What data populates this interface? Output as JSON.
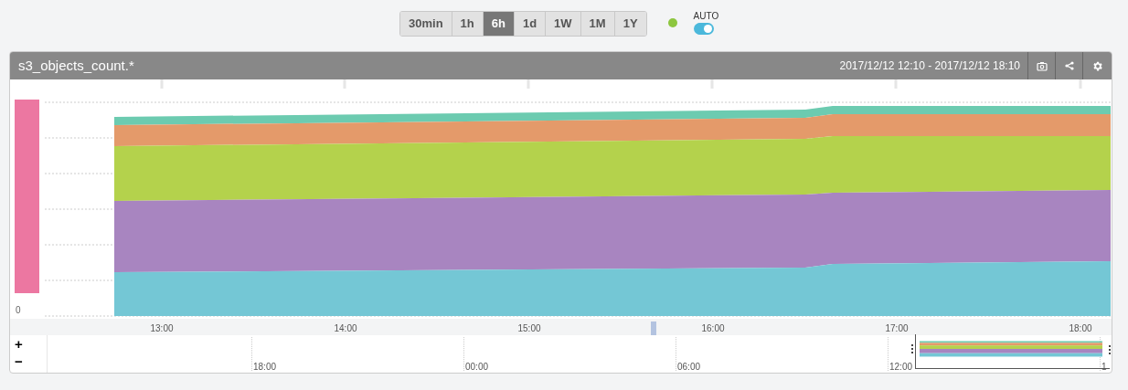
{
  "range_buttons": [
    {
      "label": "30min",
      "selected": false
    },
    {
      "label": "1h",
      "selected": false
    },
    {
      "label": "6h",
      "selected": true
    },
    {
      "label": "1d",
      "selected": false
    },
    {
      "label": "1W",
      "selected": false
    },
    {
      "label": "1M",
      "selected": false
    },
    {
      "label": "1Y",
      "selected": false
    }
  ],
  "auto_refresh": {
    "label": "AUTO",
    "on": true
  },
  "panel": {
    "title": "s3_objects_count.*",
    "time_range": "2017/12/12 12:10 - 2017/12/12 18:10",
    "y_axis_labels": [
      "0"
    ],
    "x_axis_labels": [
      "13:00",
      "14:00",
      "15:00",
      "16:00",
      "17:00",
      "18:00"
    ],
    "navigator": {
      "zoom_in": "+",
      "zoom_out": "−",
      "labels": [
        "18:00",
        "00:00",
        "06:00",
        "12:00",
        "1"
      ]
    }
  }
}
